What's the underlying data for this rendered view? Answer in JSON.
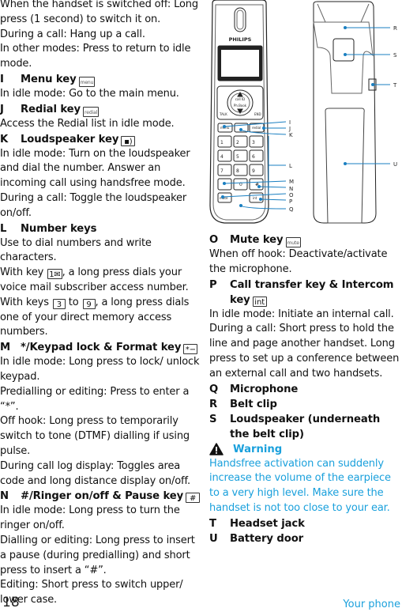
{
  "left_column": {
    "intro": [
      "When the handset is switched off: Long press (1 second) to switch it on.",
      "During a call: Hang up a call.",
      "In other modes: Press to return to idle mode."
    ],
    "items": [
      {
        "letter": "I",
        "title": "Menu key",
        "key_icon": "menu",
        "lines": [
          "In idle mode: Go to the main menu."
        ]
      },
      {
        "letter": "J",
        "title": "Redial key",
        "key_icon": "redial",
        "lines": [
          "Access the Redial list in idle mode."
        ]
      },
      {
        "letter": "K",
        "title": "Loudspeaker key",
        "key_icon": "▪)",
        "lines": [
          "In idle mode: Turn on the loudspeaker and dial the number. Answer an incoming call using handsfree mode.",
          "During a call: Toggle the loudspeaker on/off."
        ]
      },
      {
        "letter": "L",
        "title": "Number keys",
        "key_icon": "",
        "lines": [
          "Use to dial numbers and write characters."
        ],
        "key1_pre": "With key ",
        "key1_icon": "1✉",
        "key1_post": ", a long press dials your voice mail subscriber access number.",
        "key39_pre": "With keys ",
        "key3_icon": "3",
        "key39_mid": " to ",
        "key9_icon": "9",
        "key39_post": ", a long press dials one of your direct memory access numbers."
      },
      {
        "letter": "M",
        "title": "*/Keypad lock & Format key",
        "key_icon": "*−",
        "lines": [
          "In idle mode: Long press to lock/ unlock keypad.",
          "Predialling or editing: Press to enter a “*”.",
          "Off hook: Long press to temporarily switch to tone (DTMF) dialling if using pulse.",
          "During call log display: Toggles area code and long distance display on/off."
        ]
      },
      {
        "letter": "N",
        "title": "#/Ringer on/off & Pause key",
        "key_icon": "#",
        "lines": [
          "In idle mode: Long press to turn the ringer on/off.",
          "Dialling or editing: Long press to insert a pause (during predialling) and short press to insert a “#”.",
          "Editing: Short press to switch upper/ lower case."
        ]
      }
    ]
  },
  "right_column": {
    "items_top": [
      {
        "letter": "O",
        "title": "Mute key",
        "key_icon": "mute",
        "lines": [
          "When off hook: Deactivate/activate the microphone."
        ]
      },
      {
        "letter": "P",
        "title": "Call transfer key & Intercom key",
        "key_icon": "int",
        "lines": [
          "In idle mode: Initiate an internal call.",
          "During a call: Short press to hold the line and page another handset. Long press to set up a conference between an external call and two handsets."
        ]
      },
      {
        "letter": "Q",
        "title": "Microphone"
      },
      {
        "letter": "R",
        "title": "Belt clip"
      },
      {
        "letter": "S",
        "title": "Loudspeaker  (underneath the belt clip)"
      }
    ],
    "warning": {
      "title": "Warning",
      "icon": "warning-icon",
      "text": "Handsfree activation can suddenly increase the volume of the earpiece to a very high level. Make sure the handset is not too close to your ear.",
      "color": "#1aa0dc"
    },
    "items_bottom": [
      {
        "letter": "T",
        "title": "Headset jack"
      },
      {
        "letter": "U",
        "title": "Battery door"
      }
    ]
  },
  "figure": {
    "brand": "PHILIPS",
    "front_callouts": [
      "I",
      "J",
      "K",
      "L",
      "M",
      "N",
      "O",
      "P",
      "Q"
    ],
    "back_callouts": [
      "R",
      "S",
      "T",
      "U"
    ],
    "keys": {
      "talk": "TALK",
      "end": "END",
      "menu": "menu",
      "redial": "redial",
      "mute": "mute",
      "int": "int",
      "digits": [
        "1",
        "2",
        "3",
        "4",
        "5",
        "6",
        "7",
        "8",
        "9",
        "*",
        "0",
        "#"
      ],
      "nav_up": "call ID",
      "nav_down": "Ph.Book"
    },
    "accent_color": "#1a7fc1"
  },
  "footer": {
    "page_number": "18",
    "section": "Your phone"
  }
}
